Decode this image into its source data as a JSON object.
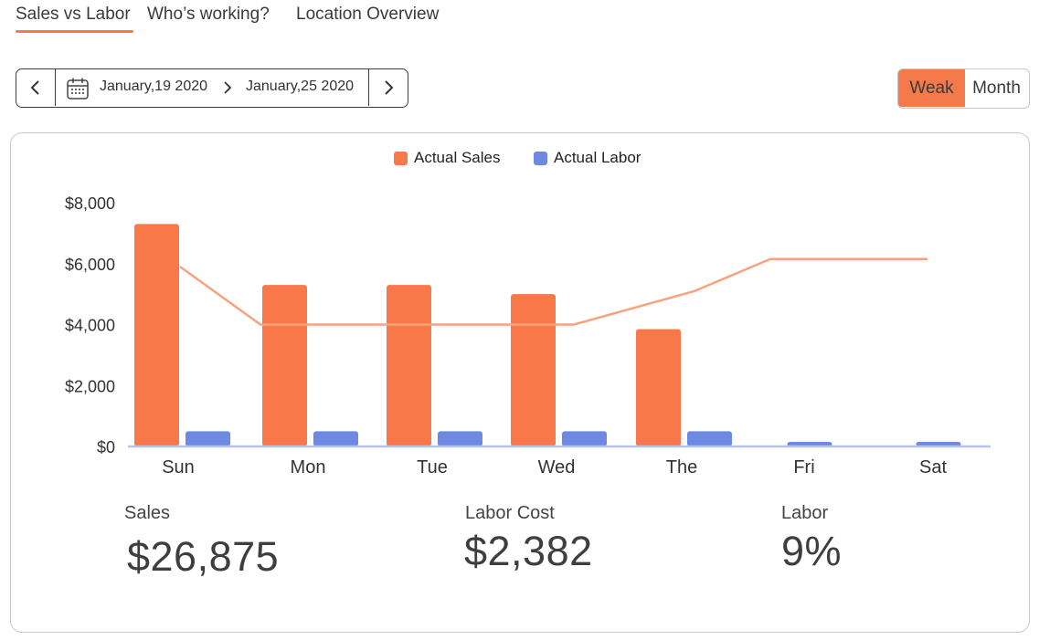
{
  "tabs": [
    {
      "label": "Sales vs Labor",
      "active": true
    },
    {
      "label": "Who’s working?",
      "active": false
    },
    {
      "label": "Location Overview",
      "active": false
    }
  ],
  "date_range": {
    "start": "January,19 2020",
    "end": "January,25 2020",
    "icons": {
      "prev": "chevron-left-icon",
      "calendar": "calendar-icon",
      "separator": "chevron-right-icon",
      "next": "chevron-right-icon"
    }
  },
  "period_toggle": {
    "options": [
      "Weak",
      "Month"
    ],
    "selected": "Weak"
  },
  "colors": {
    "accent": "#f47a4b",
    "sales": "#f8784a",
    "labor": "#6d89e2",
    "line": "#f7a27e",
    "axis": "#b7c4e8"
  },
  "chart_data": {
    "type": "bar",
    "categories": [
      "Sun",
      "Mon",
      "Tue",
      "Wed",
      "The",
      "Fri",
      "Sat"
    ],
    "series": [
      {
        "name": "Actual Sales",
        "type": "bar",
        "values": [
          7300,
          5300,
          5300,
          5000,
          3850,
          0,
          0
        ]
      },
      {
        "name": "Actual Labor",
        "type": "bar",
        "values": [
          500,
          500,
          500,
          500,
          500,
          150,
          150
        ]
      },
      {
        "type": "line",
        "values": [
          5900,
          4000,
          4000,
          4000,
          5100,
          6150,
          6150
        ]
      }
    ],
    "yticks": [
      "$0",
      "$2,000",
      "$4,000",
      "$6,000",
      "$8,000"
    ],
    "ylim": [
      0,
      8000
    ],
    "legend": "top-center",
    "grid": false
  },
  "stats": [
    {
      "label": "Sales",
      "value": "$26,875"
    },
    {
      "label": "Labor Cost",
      "value": "$2,382"
    },
    {
      "label": "Labor",
      "value": "9%"
    }
  ]
}
